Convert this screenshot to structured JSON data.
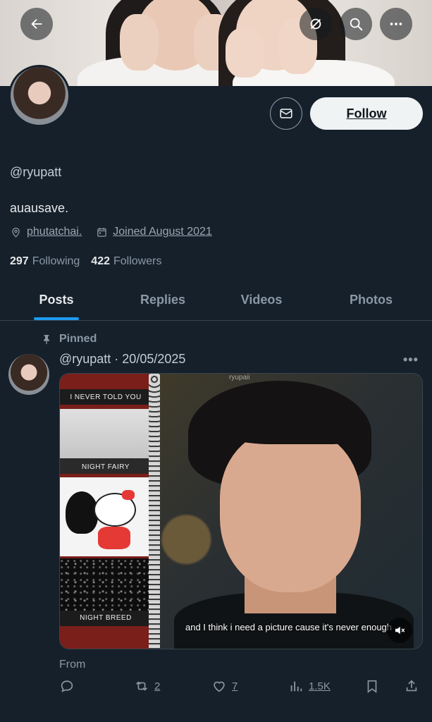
{
  "profile": {
    "handle": "@ryupatt",
    "bio": "auausave.",
    "location": "phutatchai.",
    "joined": "Joined August 2021",
    "following_count": "297",
    "following_label": "Following",
    "followers_count": "422",
    "followers_label": "Followers"
  },
  "header": {
    "follow_label": "Follow"
  },
  "tabs": [
    {
      "label": "Posts",
      "active": true
    },
    {
      "label": "Replies",
      "active": false
    },
    {
      "label": "Videos",
      "active": false
    },
    {
      "label": "Photos",
      "active": false
    }
  ],
  "post": {
    "pinned_label": "Pinned",
    "header": "@ryupatt · 20/05/2025",
    "more": "•••",
    "media": {
      "strip_labels": [
        "I NEVER TOLD YOU",
        "NIGHT  FAIRY",
        "NIGHT  BREED"
      ],
      "watermark": "ryupaii",
      "caption": "and I think i need a picture cause it's never enough"
    },
    "from_label": "From",
    "actions": {
      "replies": "",
      "reposts": "2",
      "likes": "7",
      "views": "1.5K"
    }
  },
  "colors": {
    "background": "#15202b",
    "accent": "#1d9bf0",
    "text_primary": "#e7e9ea",
    "text_secondary": "#8b98a5",
    "follow_bg": "#eff3f4"
  },
  "icons": [
    "back-arrow-icon",
    "hide-media-icon",
    "search-icon",
    "more-icon",
    "mail-icon",
    "location-pin-icon",
    "calendar-icon",
    "pin-icon",
    "reply-icon",
    "repost-icon",
    "like-icon",
    "views-icon",
    "bookmark-icon",
    "share-icon",
    "mute-icon"
  ]
}
